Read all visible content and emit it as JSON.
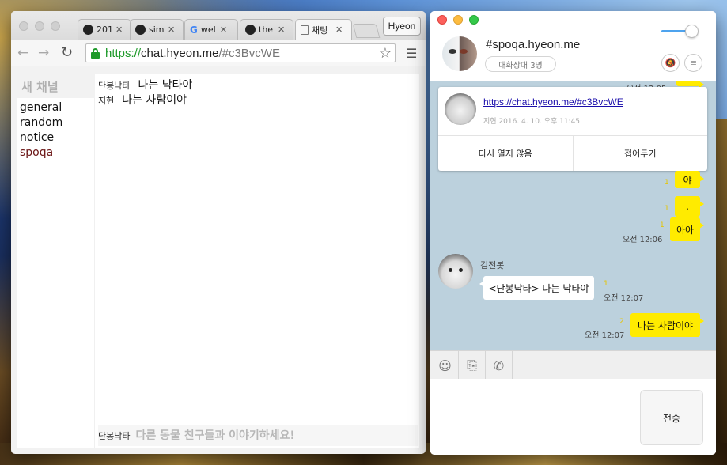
{
  "browser": {
    "tabs": [
      {
        "title": "201",
        "icon": "github-icon"
      },
      {
        "title": "sim",
        "icon": "github-icon"
      },
      {
        "title": "wel",
        "icon": "google-icon"
      },
      {
        "title": "the",
        "icon": "github-icon"
      },
      {
        "title": "채팅",
        "icon": "document-icon"
      }
    ],
    "profile_label": "Hyeon",
    "url": {
      "scheme": "https://",
      "host": "chat.hyeon.me",
      "rest": "/#c3BvcWE"
    },
    "page": {
      "new_channel_label": "새 채널",
      "channels": [
        "general",
        "random",
        "notice",
        "spoqa"
      ],
      "current_channel": "spoqa",
      "messages": [
        {
          "author": "단봉낙타",
          "text": "나는 낙타야"
        },
        {
          "author": "지현",
          "text": "나는 사람이야"
        }
      ],
      "composer": {
        "nickname": "단봉낙타",
        "placeholder": "다른 동물 친구들과 이야기하세요!"
      }
    }
  },
  "chat_app": {
    "room_name": "#spoqa.hyeon.me",
    "member_count_label": "대화상대 3명",
    "volume_level": 0.85,
    "link_card": {
      "url": "https://chat.hyeon.me/#c3BvcWE",
      "meta": "지현 2016. 4. 10. 오후 11:45",
      "dismiss_label": "다시 열지 않음",
      "collapse_label": "접어두기"
    },
    "messages": {
      "top_timestamp": "오전 12:05",
      "mine_1": {
        "text": "야",
        "unread": "1"
      },
      "mine_2": {
        "text": ".",
        "unread": "1"
      },
      "mine_3": {
        "text": "아아",
        "unread": "1",
        "time": "오전 12:06"
      },
      "bot": {
        "name": "김전봇",
        "text": "<단봉낙타> 나는 낙타야",
        "unread": "1",
        "time": "오전 12:07"
      },
      "mine_4": {
        "text": "나는 사람이야",
        "unread": "2",
        "time": "오전 12:07"
      }
    },
    "send_label": "전송",
    "colors": {
      "chat_bg": "#bcd1dd",
      "my_bubble": "#ffeb00",
      "link": "#1a0dab",
      "volume": "#4ea3ee"
    }
  }
}
